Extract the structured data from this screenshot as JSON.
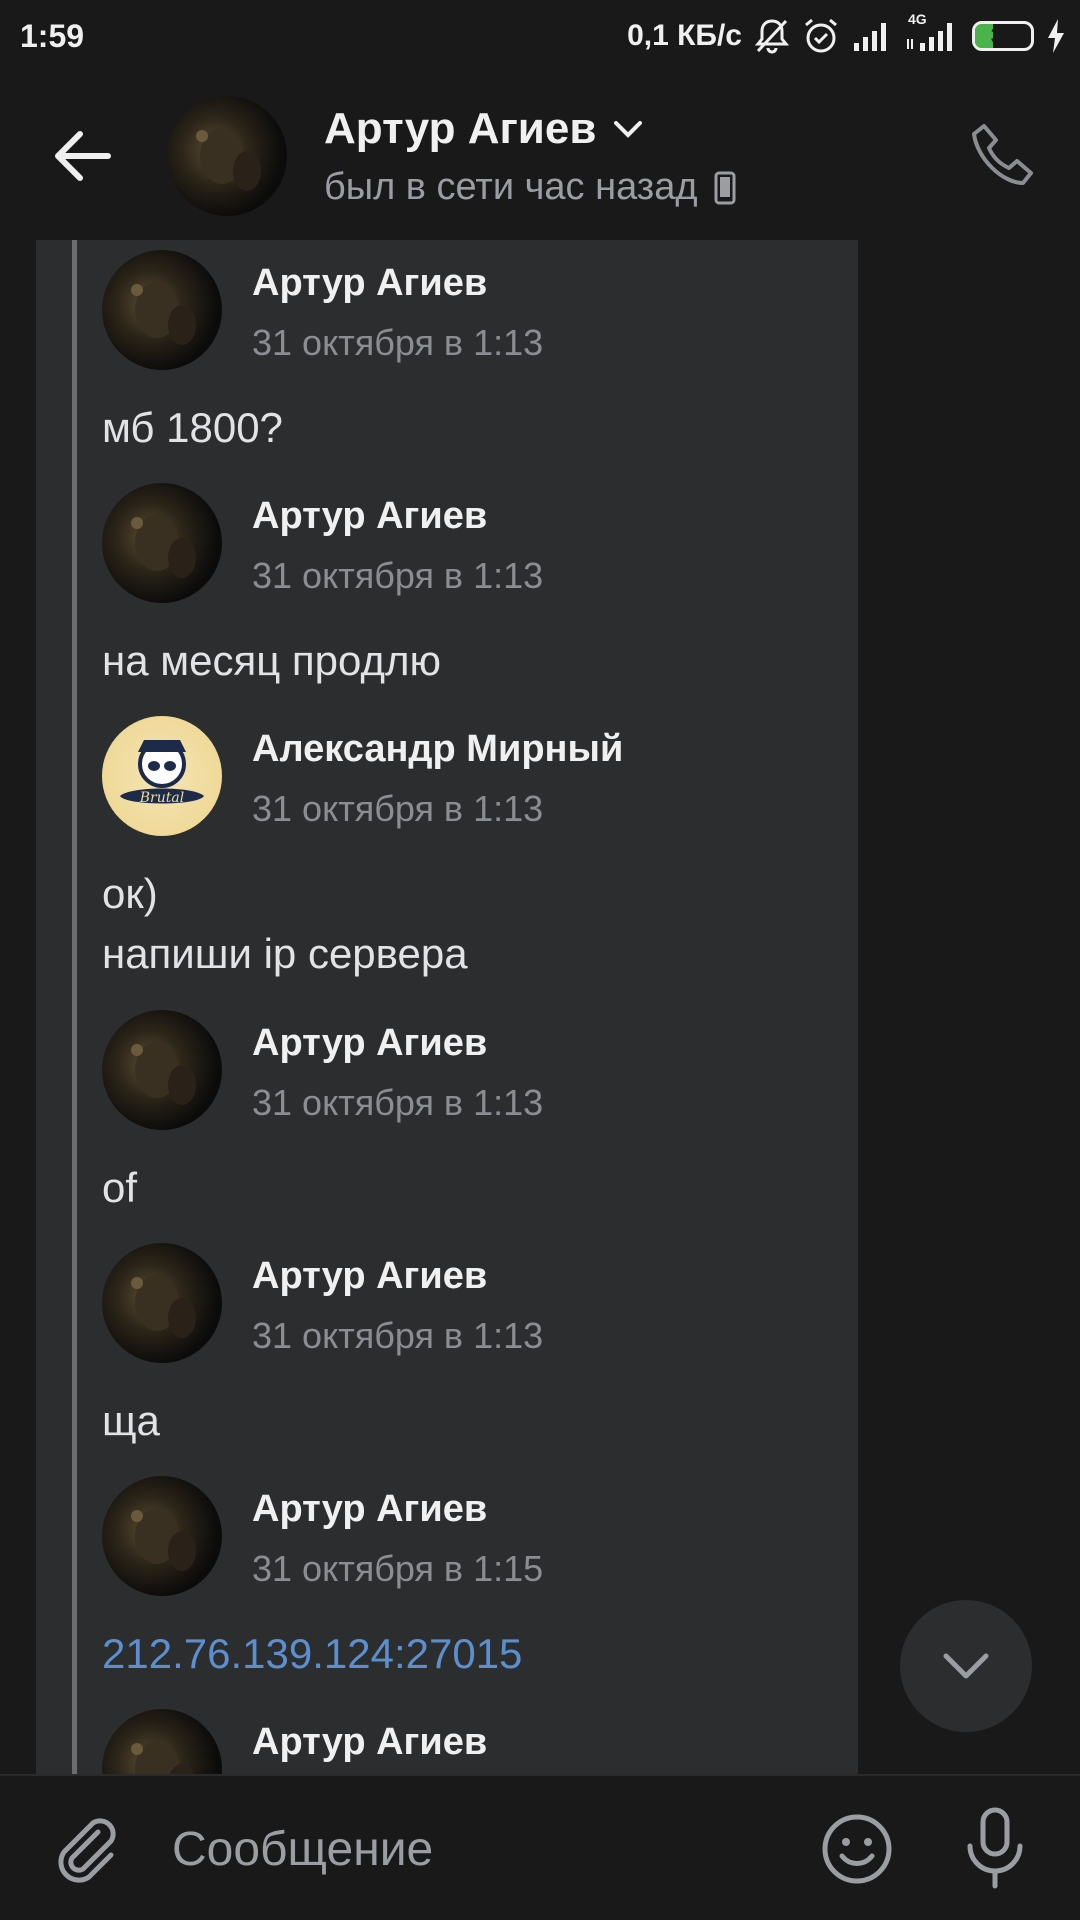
{
  "status_bar": {
    "time": "1:59",
    "net_speed": "0,1 КБ/с",
    "network": "4G",
    "battery": "32",
    "battery_level": 0.32
  },
  "header": {
    "name": "Артур Агиев",
    "status": "был в сети час назад",
    "icons": [
      "back-arrow-icon",
      "chevron-down-icon",
      "mobile-icon",
      "phone-icon"
    ]
  },
  "messages": [
    {
      "author": "Артур Агиев",
      "date": "31 октября в 1:13",
      "text": "мб 1800?",
      "avatar": "photo-dark"
    },
    {
      "author": "Артур Агиев",
      "date": "31 октября в 1:13",
      "text": "на месяц продлю",
      "avatar": "photo-dark"
    },
    {
      "author": "Александр Мирный",
      "date": "31 октября в 1:13",
      "text": "ок)\nнапиши ip сервера",
      "avatar": "brutal-panda"
    },
    {
      "author": "Артур Агиев",
      "date": "31 октября в 1:13",
      "text": "of",
      "avatar": "photo-dark"
    },
    {
      "author": "Артур Агиев",
      "date": "31 октября в 1:13",
      "text": "ща",
      "avatar": "photo-dark"
    },
    {
      "author": "Артур Агиев",
      "date": "31 октября в 1:15",
      "text": "212.76.139.124:27015",
      "avatar": "photo-dark",
      "link": true
    },
    {
      "author": "Артур Агиев",
      "date": "",
      "text": "",
      "avatar": "photo-dark"
    }
  ],
  "composer": {
    "placeholder": "Сообщение",
    "icons": [
      "paperclip-icon",
      "emoji-icon",
      "microphone-icon"
    ]
  },
  "colors": {
    "background": "#191919",
    "bubble": "#2c2d2f",
    "link": "#5b8fd0",
    "secondary_text": "#8a8d91"
  }
}
